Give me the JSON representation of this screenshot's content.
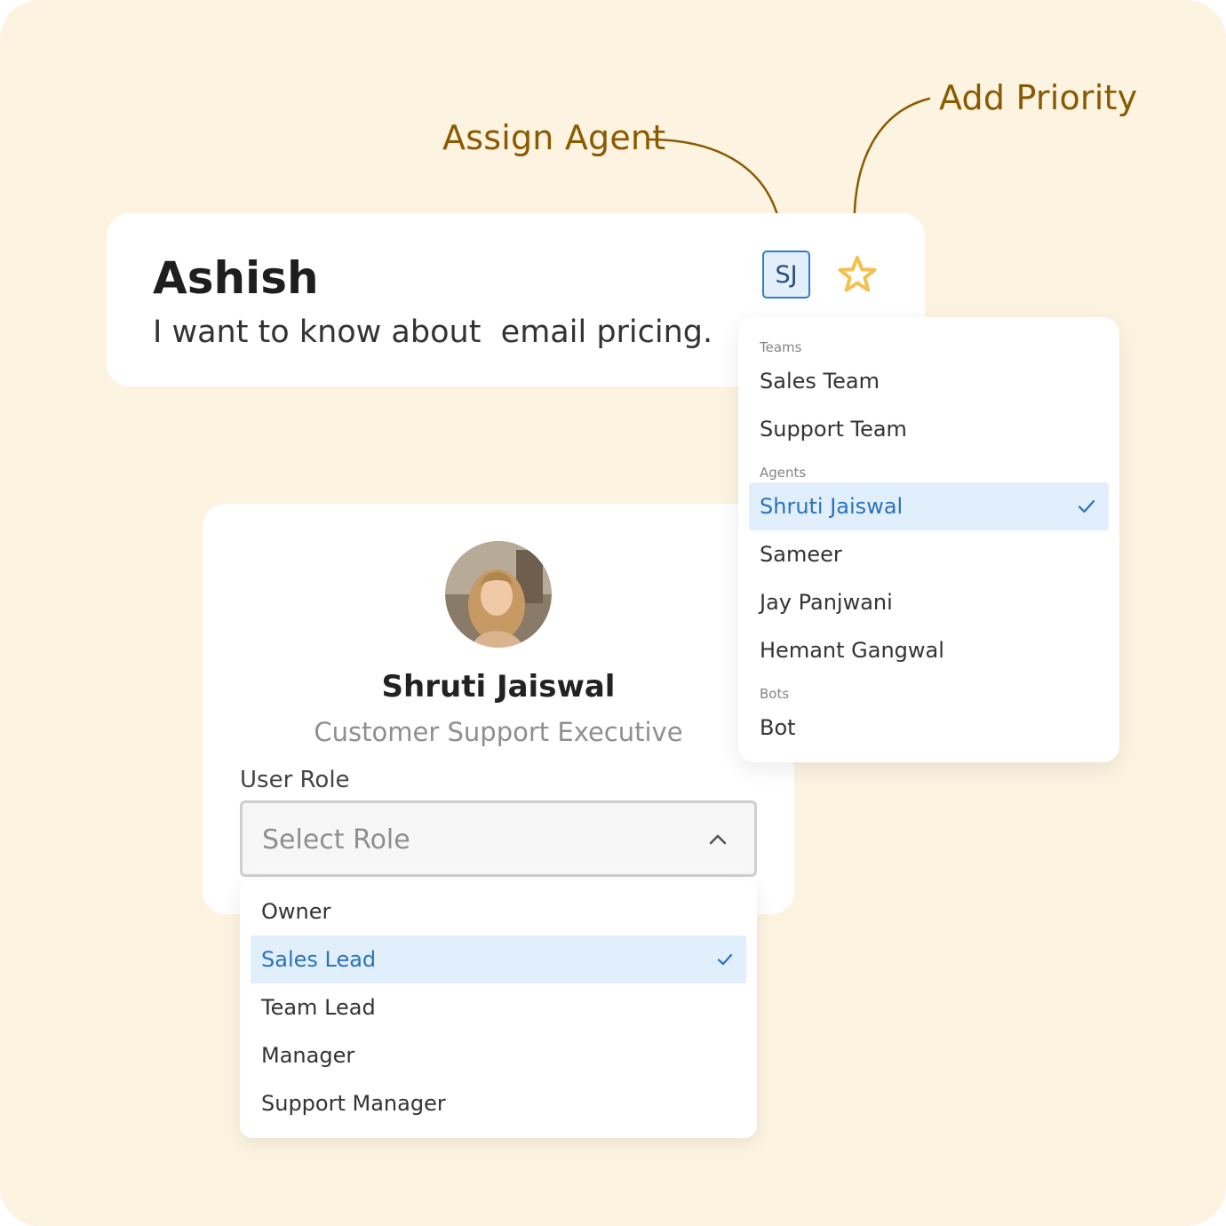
{
  "annotations": {
    "assign_agent": "Assign Agent",
    "add_priority": "Add Priority"
  },
  "conversation": {
    "contact_name": "Ashish",
    "message": "I want to know about  email pricing.",
    "assignee_initials": "SJ",
    "priority_icon": "star-icon"
  },
  "assign_menu": {
    "teams_label": "Teams",
    "teams": [
      "Sales Team",
      "Support Team"
    ],
    "agents_label": "Agents",
    "agents": [
      "Shruti Jaiswal",
      "Sameer",
      "Jay Panjwani",
      "Hemant Gangwal"
    ],
    "selected_agent": "Shruti Jaiswal",
    "bots_label": "Bots",
    "bots": [
      "Bot"
    ]
  },
  "profile": {
    "name": "Shruti Jaiswal",
    "title": "Customer Support Executive",
    "role_label": "User Role",
    "role_placeholder": "Select Role"
  },
  "role_menu": {
    "options": [
      "Owner",
      "Sales Lead",
      "Team Lead",
      "Manager",
      "Support Manager"
    ],
    "selected": "Sales Lead"
  },
  "colors": {
    "background": "#fdf3e1",
    "annotation": "#8a5a00",
    "accent_blue": "#2b73b9",
    "selected_bg": "#e1eefc",
    "star": "#f2c14e"
  }
}
